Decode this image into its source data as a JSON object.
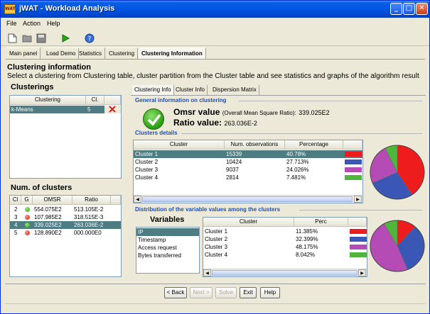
{
  "window": {
    "title": "jWAT - Workload Analysis",
    "app_icon_text": "WAT"
  },
  "menu": [
    "File",
    "Action",
    "Help"
  ],
  "toolbar_icons": [
    "new-icon",
    "open-icon",
    "save-icon",
    "run-icon",
    "help-icon"
  ],
  "main_tabs": [
    "Main panel",
    "Load Demo",
    "Statistics",
    "Clustering",
    "Clustering Information"
  ],
  "main_tab_active": "Clustering Information",
  "page": {
    "heading": "Clustering information",
    "subheading": "Select a clustering from Clustering table, cluster partition from the Cluster table and see statistics and graphs of the algorithm result"
  },
  "clusterings": {
    "title": "Clusterings",
    "headers": [
      "Clustering",
      "Cl."
    ],
    "rows": [
      {
        "name": "k-Means",
        "cl": "5"
      }
    ]
  },
  "num_clusters": {
    "title": "Num. of clusters",
    "headers": [
      "Cl",
      "G",
      "OMSR",
      "Ratio"
    ],
    "rows": [
      {
        "cl": "2",
        "g": "green",
        "omsr": "554.075E2",
        "ratio": "513.105E-2"
      },
      {
        "cl": "3",
        "g": "red",
        "omsr": "107.985E2",
        "ratio": "318.515E-3"
      },
      {
        "cl": "4",
        "g": "green",
        "omsr": "339.025E2",
        "ratio": "263.036E-2"
      },
      {
        "cl": "5",
        "g": "red",
        "omsr": "128.890E2",
        "ratio": "000.000E0"
      }
    ],
    "selected_index": 2
  },
  "sub_tabs": [
    "Clustering Info",
    "Cluster Info",
    "Dispersion Matrix"
  ],
  "general": {
    "title": "General information on clustering",
    "omsr_label": "Omsr value",
    "omsr_note": "(Overall Mean Square Ratio):",
    "omsr_value": "339.025E2",
    "ratio_label": "Ratio value:",
    "ratio_value": "263.036E-2"
  },
  "clusters_details": {
    "title": "Clusters details",
    "headers": [
      "Cluster",
      "Num. observations",
      "Percentage"
    ],
    "rows": [
      {
        "cluster": "Cluster 1",
        "obs": "15339",
        "pct": "40.78%",
        "color": "#ee1c1c"
      },
      {
        "cluster": "Cluster 2",
        "obs": "10424",
        "pct": "27.713%",
        "color": "#3b57b5"
      },
      {
        "cluster": "Cluster 3",
        "obs": "9037",
        "pct": "24.026%",
        "color": "#b54bb5"
      },
      {
        "cluster": "Cluster 4",
        "obs": "2814",
        "pct": "7.481%",
        "color": "#52b53b"
      }
    ],
    "selected_index": 0
  },
  "distribution": {
    "title": "Distribution of the variable values among the clusters",
    "vars_title": "Variables",
    "variables": [
      "IP",
      "Timestamp",
      "Access request",
      "Bytes transferred"
    ],
    "selected_variable": 0,
    "headers": [
      "Cluster",
      "Perc"
    ],
    "rows": [
      {
        "cluster": "Cluster 1",
        "perc": "11.385%",
        "color": "#ee1c1c"
      },
      {
        "cluster": "Cluster 2",
        "perc": "32.399%",
        "color": "#3b57b5"
      },
      {
        "cluster": "Cluster 3",
        "perc": "48.175%",
        "color": "#b54bb5"
      },
      {
        "cluster": "Cluster 4",
        "perc": "8.042%",
        "color": "#52b53b"
      }
    ]
  },
  "buttons": {
    "back": "< Back",
    "next": "Next >",
    "solve": "Solve",
    "exit": "Exit",
    "help": "Help"
  }
}
